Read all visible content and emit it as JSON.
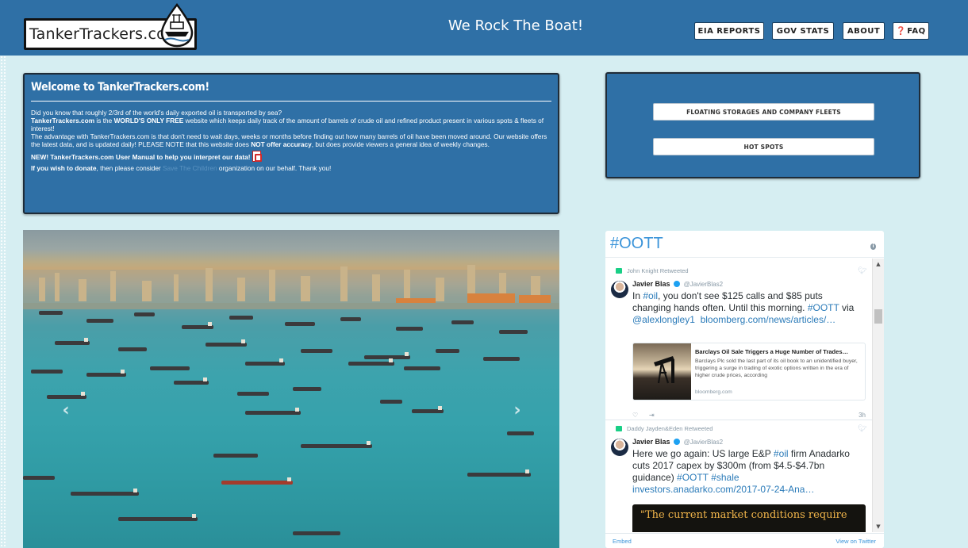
{
  "header": {
    "logo_text": "TankerTrackers.com",
    "slogan": "We Rock The Boat!",
    "nav": [
      {
        "label": "EIA REPORTS"
      },
      {
        "label": "GOV STATS"
      },
      {
        "label": "ABOUT"
      },
      {
        "label": "FAQ",
        "icon": "question-circle-icon"
      }
    ]
  },
  "welcome": {
    "title": "Welcome to TankerTrackers.com!",
    "p1": "Did you know that roughly 2/3rd of the world's daily exported oil is transported by sea?",
    "p2_brand": "TankerTrackers.com",
    "p2_is": " is the ",
    "p2_bold": "WORLD'S ONLY FREE",
    "p2_rest": " website which keeps daily track of the amount of barrels of crude oil and refined product present in various spots & fleets of interest!",
    "p3_a": "The advantage with TankerTrackers.com is that don't need to wait days, weeks or months before finding out how many barrels of oil have been moved around. Our website offers the latest data, and is updated daily! PLEASE NOTE that this website does ",
    "p3_bold": "NOT offer accuracy",
    "p3_b": ", but does provide viewers a general idea of weekly changes.",
    "p4": "NEW! TankerTrackers.com User Manual to help you interpret our data!",
    "p5_bold": "If you wish to donate",
    "p5_a": ", then please consider ",
    "p5_link": "Save The Children",
    "p5_b": " organization on our behalf. Thank you!"
  },
  "quick_links": [
    {
      "label": "FLOATING STORAGES AND COMPANY FLEETS"
    },
    {
      "label": "HOT SPOTS"
    }
  ],
  "carousel": {
    "prev": "‹",
    "next": "›"
  },
  "twitter": {
    "title": "#OOTT",
    "tweets": [
      {
        "retweeted_by": "John Knight Retweeted",
        "author": "Javier Blas",
        "handle": "@JavierBlas2",
        "text_a": "In ",
        "tag1": "#oil",
        "text_b": ", you don't see $125 calls and $85 puts changing hands often. Until this morning. ",
        "tag2": "#OOTT",
        "text_c": " via ",
        "mention": "@alexlongley1",
        "link": "bloomberg.com/news/articles/…",
        "card_title": "Barclays Oil Sale Triggers a Huge Number of Trades…",
        "card_desc": "Barclays Plc sold the last part of its oil book to an unidentified buyer, triggering a surge in trading of exotic options written in the era of higher crude prices, according",
        "card_domain": "bloomberg.com",
        "time": "3h"
      },
      {
        "retweeted_by": "Daddy Jayden&Eden Retweeted",
        "author": "Javier Blas",
        "handle": "@JavierBlas2",
        "text_a": "Here we go again: US large E&P ",
        "tag1": "#oil",
        "text_b": " firm Anadarko cuts 2017 capex by $300m (from $4.5-$4.7bn guidance) ",
        "tag2": "#OOTT",
        "tag3": "#shale",
        "link": "investors.anadarko.com/2017-07-24-Ana…",
        "quote": "\"The current market conditions require"
      }
    ],
    "embed": "Embed",
    "view": "View on Twitter"
  }
}
